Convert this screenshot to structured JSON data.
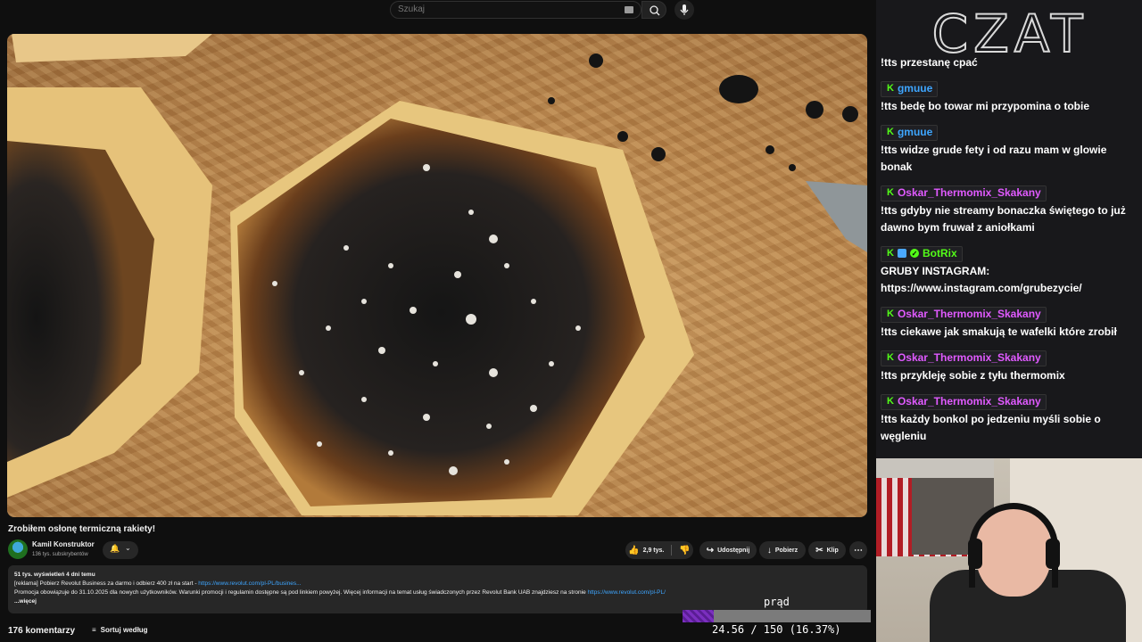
{
  "search": {
    "placeholder": "Szukaj"
  },
  "video": {
    "title": "Zrobiłem osłonę termiczną rakiety!",
    "channel": "Kamil Konstruktor",
    "subscribers": "136 tys. subskrybentów",
    "likes": "2,9 tys.",
    "share_label": "Udostępnij",
    "download_label": "Pobierz",
    "clip_label": "Klip"
  },
  "description": {
    "stats": "51 tys. wyświetleń  4 dni temu",
    "line1_prefix": "[reklama] Pobierz Revolut Business za darmo i odbierz 400 zł na start - ",
    "line1_link": "https://www.revolut.com/pl-PL/busines...",
    "line2_prefix": "Promocja obowiązuje do 31.10.2025 dla nowych użytkowników. Warunki promocji i regulamin dostępne są pod linkiem powyżej. Więcej informacji na temat usług świadczonych przez Revolut Bank UAB znajdziesz na stronie ",
    "line2_link": "https://www.revolut.com/pl-PL/",
    "more": "...więcej"
  },
  "comments": {
    "count": "176 komentarzy",
    "sort_label": "Sortuj według"
  },
  "goal": {
    "label": "prąd",
    "current": 24.56,
    "target": 150,
    "text": "24.56 / 150 (16.37%)",
    "fraction": 0.1637
  },
  "chat": {
    "logo": "CZAT",
    "messages": [
      {
        "text": "!tts przestanę cpać"
      },
      {
        "user": "gmuue",
        "color": "#3ea6ff",
        "text": "!tts bedę bo towar mi przypomina o tobie"
      },
      {
        "user": "gmuue",
        "color": "#3ea6ff",
        "text": "!tts widze grude fety i od razu mam w glowie bonak"
      },
      {
        "user": "Oskar_Thermomix_Skakany",
        "color": "#e05aff",
        "text": "!tts gdyby nie streamy bonaczka świętego to już dawno bym fruwał z aniołkami"
      },
      {
        "user": "BotRix",
        "color": "#53fc18",
        "text": "GRUBY INSTAGRAM: https://www.instagram.com/grubezycie/"
      },
      {
        "user": "Oskar_Thermomix_Skakany",
        "color": "#e05aff",
        "text": "!tts ciekawe jak smakują te wafelki które zrobił"
      },
      {
        "user": "Oskar_Thermomix_Skakany",
        "color": "#e05aff",
        "text": "!tts przykleję sobie z tyłu thermomix"
      },
      {
        "user": "Oskar_Thermomix_Skakany",
        "color": "#e05aff",
        "text": "!tts każdy bonkol po jedzeniu myśli sobie o węgleniu"
      }
    ]
  }
}
